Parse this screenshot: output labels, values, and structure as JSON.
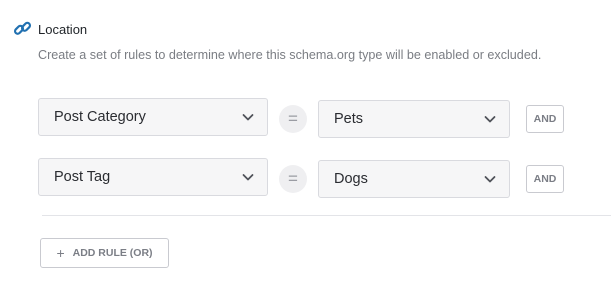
{
  "section": {
    "title": "Location",
    "description": "Create a set of rules to determine where this schema.org type will be enabled or excluded."
  },
  "rules": [
    {
      "field": "Post Category",
      "operator": "=",
      "value": "Pets",
      "connector": "AND"
    },
    {
      "field": "Post Tag",
      "operator": "=",
      "value": "Dogs",
      "connector": "AND"
    }
  ],
  "actions": {
    "add_rule_icon": "+",
    "add_rule_label": "ADD RULE (OR)"
  },
  "colors": {
    "accent": "#2271b1",
    "select_bg": "#f6f6f7",
    "border": "#d9dadf",
    "muted_text": "#7a7d83"
  },
  "icons": {
    "header": "link-icon",
    "dropdown": "chevron-down-icon"
  }
}
